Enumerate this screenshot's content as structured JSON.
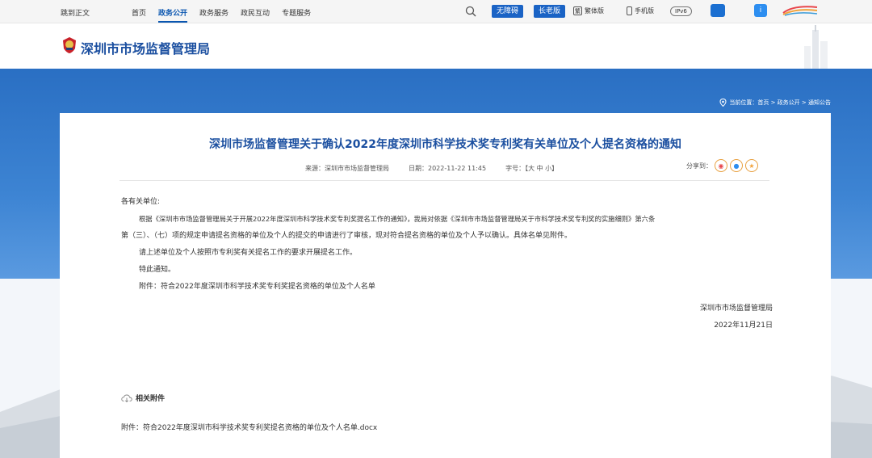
{
  "topbar": {
    "skip": "跳到正文",
    "nav": [
      "首页",
      "政务公开",
      "政务服务",
      "政民互动",
      "专题服务"
    ],
    "accessibility": "无障碍",
    "elderly": "长老版",
    "traditional": "繁体版",
    "mobile": "手机版",
    "ipv6": "IPv6"
  },
  "header": {
    "title": "深圳市市场监督管理局"
  },
  "breadcrumb": "当前位置：首页 > 政务公开 > 通知公告",
  "article": {
    "title": "深圳市场监督管理关于确认2022年度深圳市科学技术奖专利奖有关单位及个人提名资格的通知",
    "source": "来源：深圳市市场监督管理局",
    "date": "日期：2022-11-22 11:45",
    "fontsize": "字号：【大  中  小】",
    "share_label": "分享到：",
    "salutation": "各有关单位:",
    "p1a": "根据《深圳市市场监督管理局关于开展2022年度深圳市科学技术奖专利奖提名工作的通知》，我局对依据《深圳市市场监督管理局关于市科学技术奖专利奖的实施细则》第六条",
    "p1b": "第（三）、（七）项的规定申请提名资格的单位及个人的提交的申请进行了审核，现对符合提名资格的单位及个人予以确认。具体名单见附件。",
    "p2": "请上述单位及个人按照市专利奖有关提名工作的要求开展提名工作。",
    "p3": "特此通知。",
    "p4": "附件：符合2022年度深圳市科学技术奖专利奖提名资格的单位及个人名单",
    "sign_org": "深圳市市场监督管理局",
    "sign_date": "2022年11月21日",
    "attachments_heading": "相关附件",
    "attachment_file": "附件：符合2022年度深圳市科学技术奖专利奖提名资格的单位及个人名单.docx"
  },
  "colors": {
    "brand": "#1b4fa0",
    "band": "#2a6fc3"
  }
}
